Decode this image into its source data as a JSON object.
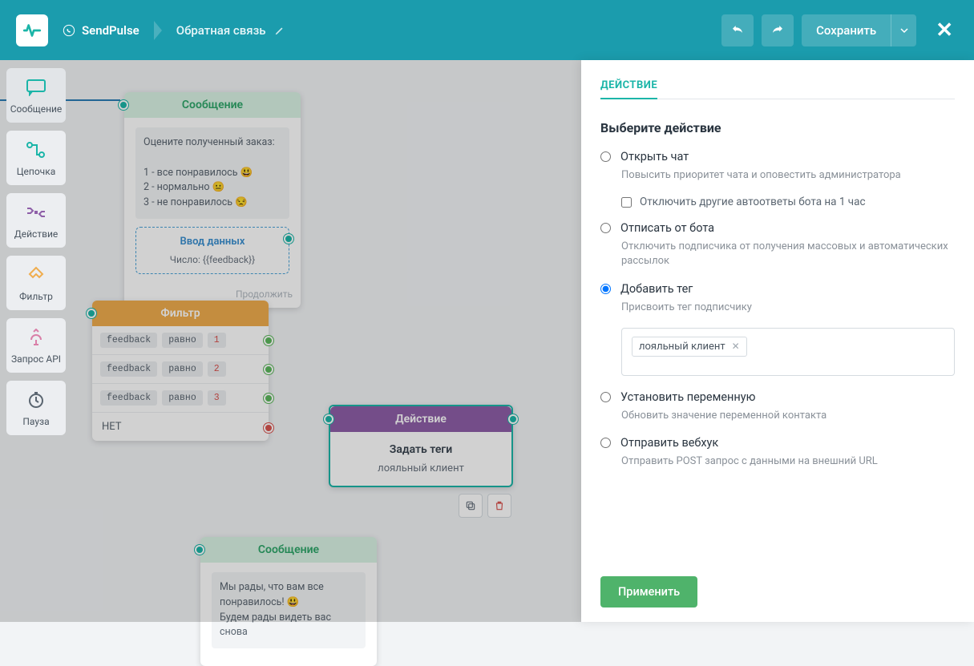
{
  "header": {
    "brand": "SendPulse",
    "flow_name": "Обратная связь",
    "save_label": "Сохранить"
  },
  "sidebar": {
    "items": [
      {
        "label": "Сообщение",
        "icon": "message"
      },
      {
        "label": "Цепочка",
        "icon": "chain"
      },
      {
        "label": "Действие",
        "icon": "action"
      },
      {
        "label": "Фильтр",
        "icon": "filter"
      },
      {
        "label": "Запрос API",
        "icon": "api"
      },
      {
        "label": "Пауза",
        "icon": "pause"
      }
    ]
  },
  "nodes": {
    "msg1": {
      "title": "Сообщение",
      "prompt": "Оцените полученный заказ:\n\n1 - все понравилось 😃\n2 - нормально 😐\n3 - не понравилось 😒",
      "input_title": "Ввод данных",
      "input_val": "Число: {{feedback}}",
      "continue": "Продолжить"
    },
    "filter": {
      "title": "Фильтр",
      "field": "feedback",
      "op": "равно",
      "vals": [
        "1",
        "2",
        "3"
      ],
      "no": "НЕТ"
    },
    "action": {
      "title": "Действие",
      "sub": "Задать теги",
      "tag": "лояльный клиент"
    },
    "msg2": {
      "title": "Сообщение",
      "body": "Мы рады, что вам все понравилось! 😃\nБудем рады видеть вас снова"
    }
  },
  "panel": {
    "tab": "ДЕЙСТВИЕ",
    "title": "Выберите действие",
    "opt_openchat": "Открыть чат",
    "opt_openchat_desc": "Повысить приоритет чата и оповестить администратора",
    "opt_openchat_cb": "Отключить другие автоответы бота на 1 час",
    "opt_unsub": "Отписать от бота",
    "opt_unsub_desc": "Отключить подписчика от получения массовых и автоматических рассылок",
    "opt_addtag": "Добавить тег",
    "opt_addtag_desc": "Присвоить тег подписчику",
    "tag_value": "лояльный клиент",
    "opt_setvar": "Установить переменную",
    "opt_setvar_desc": "Обновить значение переменной контакта",
    "opt_webhook": "Отправить вебхук",
    "opt_webhook_desc": "Отправить POST запрос с данными на внешний URL",
    "apply": "Применить"
  }
}
